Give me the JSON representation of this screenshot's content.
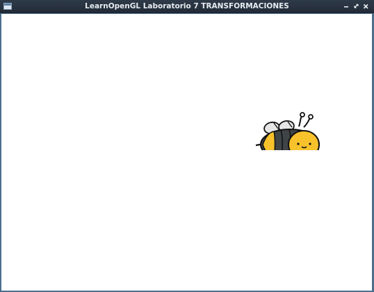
{
  "window": {
    "title": "LearnOpenGL Laboratorio 7 TRANSFORMACIONES",
    "buttons": {
      "minimize_icon": "minimize-icon",
      "restore_icon": "restore-icon",
      "close_icon": "close-icon"
    }
  },
  "canvas": {
    "background": "#ffffff",
    "sprite": {
      "icon": "bee-icon",
      "body_color": "#f7c22b",
      "stripe_color": "#3f4447",
      "wing_color": "#e6e6e6",
      "outline_color": "#111111"
    }
  }
}
